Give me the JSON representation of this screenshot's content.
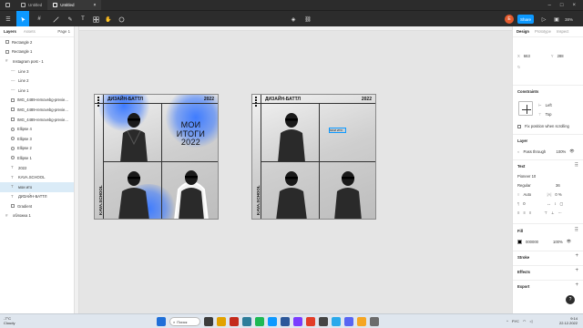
{
  "tabs": [
    {
      "label": "Untitled",
      "active": false
    },
    {
      "label": "Untitled",
      "active": true
    }
  ],
  "toolbar": {
    "avatar_letter": "E",
    "share_label": "Share",
    "zoom": "38%"
  },
  "left_panel": {
    "tabs": [
      "Layers",
      "Assets"
    ],
    "page": "Page 1",
    "layers": [
      "Rectangle 2",
      "Rectangle 1",
      "Instagram post - 1",
      "Line 3",
      "Line 2",
      "Line 1",
      "IMG_4489-removebg-previe...",
      "IMG_4489-removebg-previe...",
      "IMG_4489-removebg-previe...",
      "Ellipse 4",
      "Ellipse 3",
      "Ellipse 2",
      "Ellipse 1",
      "2022",
      "KAVA.SCHOOL",
      "мои ито",
      "ДИЗАЙН-БАТТЛ",
      "Gradient",
      "обложка 1"
    ]
  },
  "frames": {
    "left": {
      "header_name": "ДИЗАЙН-БАТТЛ",
      "header_year": "2022",
      "side_text": "KAVA.SCHOOL",
      "big_text": [
        "МОИ",
        "ИТОГИ",
        "2022"
      ]
    },
    "right": {
      "header_name": "ДИЗАЙН-БАТТЛ",
      "header_year": "2022",
      "side_text": "KAVA.SCHOOL",
      "selected_text": "МОИ ИТО"
    }
  },
  "right_panel": {
    "tabs": [
      "Design",
      "Prototype",
      "Inspect"
    ],
    "x_label": "X",
    "x_value": "663",
    "y_label": "Y",
    "y_value": "288",
    "constraints_title": "Constraints",
    "constraint_h": "Left",
    "constraint_v": "Top",
    "fix_position": "Fix position when scrolling",
    "layer_title": "Layer",
    "blend": "Pass through",
    "layer_opacity": "100%",
    "text_title": "Text",
    "font": "Pioneer 10",
    "font_weight": "Regular",
    "font_size": "36",
    "line_height": "Auto",
    "letter_spacing": "0 %",
    "paragraph": "0",
    "fill_title": "Fill",
    "fill_hex": "000000",
    "fill_opacity": "100%",
    "stroke_title": "Stroke",
    "effects_title": "Effects",
    "export_title": "Export"
  },
  "taskbar": {
    "weather_temp": "-7°C",
    "weather_desc": "Cloudy",
    "search_label": "Поиск",
    "lang": "РУС",
    "time": "9:14",
    "date": "22.12.2022"
  },
  "colors": {
    "accent": "#0d99ff",
    "gradient_blue": "#3f7cff",
    "dark_ui": "#2c2c2c"
  }
}
